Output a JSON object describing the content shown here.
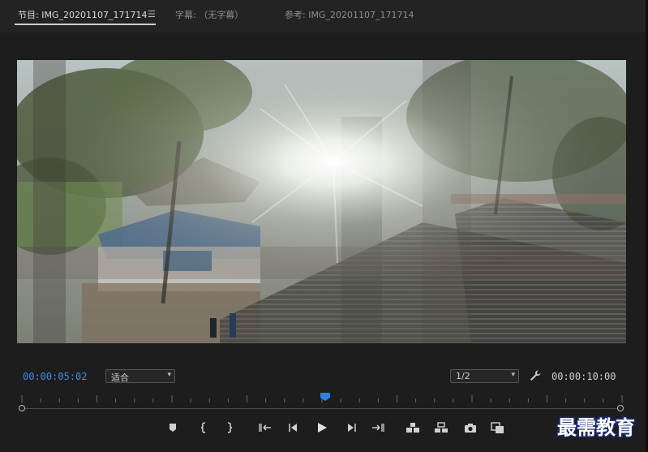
{
  "tabs": [
    {
      "label": "节目: IMG_20201107_171714",
      "active": true
    },
    {
      "label": "字幕: （无字幕）",
      "active": false
    },
    {
      "label": "参考: IMG_20201107_171714",
      "active": false
    }
  ],
  "tab_menu_icon": "hamburger-menu-icon",
  "timecode_current": "00:00:05:02",
  "zoom_select": "适合",
  "resolution_select": "1/2",
  "timecode_duration": "00:00:10:00",
  "playhead_position": 0.505,
  "watermark_text": "最需教育",
  "colors": {
    "accent_blue": "#3f8ee8",
    "panel_bg": "#1d1d1d",
    "tab_bar_bg": "#232323"
  },
  "transport_icons": [
    "add-marker-icon",
    "mark-in-icon",
    "mark-out-icon",
    "go-to-in-icon",
    "step-back-icon",
    "play-icon",
    "step-forward-icon",
    "go-to-out-icon",
    "lift-icon",
    "extract-icon",
    "export-frame-icon",
    "comparison-view-icon"
  ]
}
